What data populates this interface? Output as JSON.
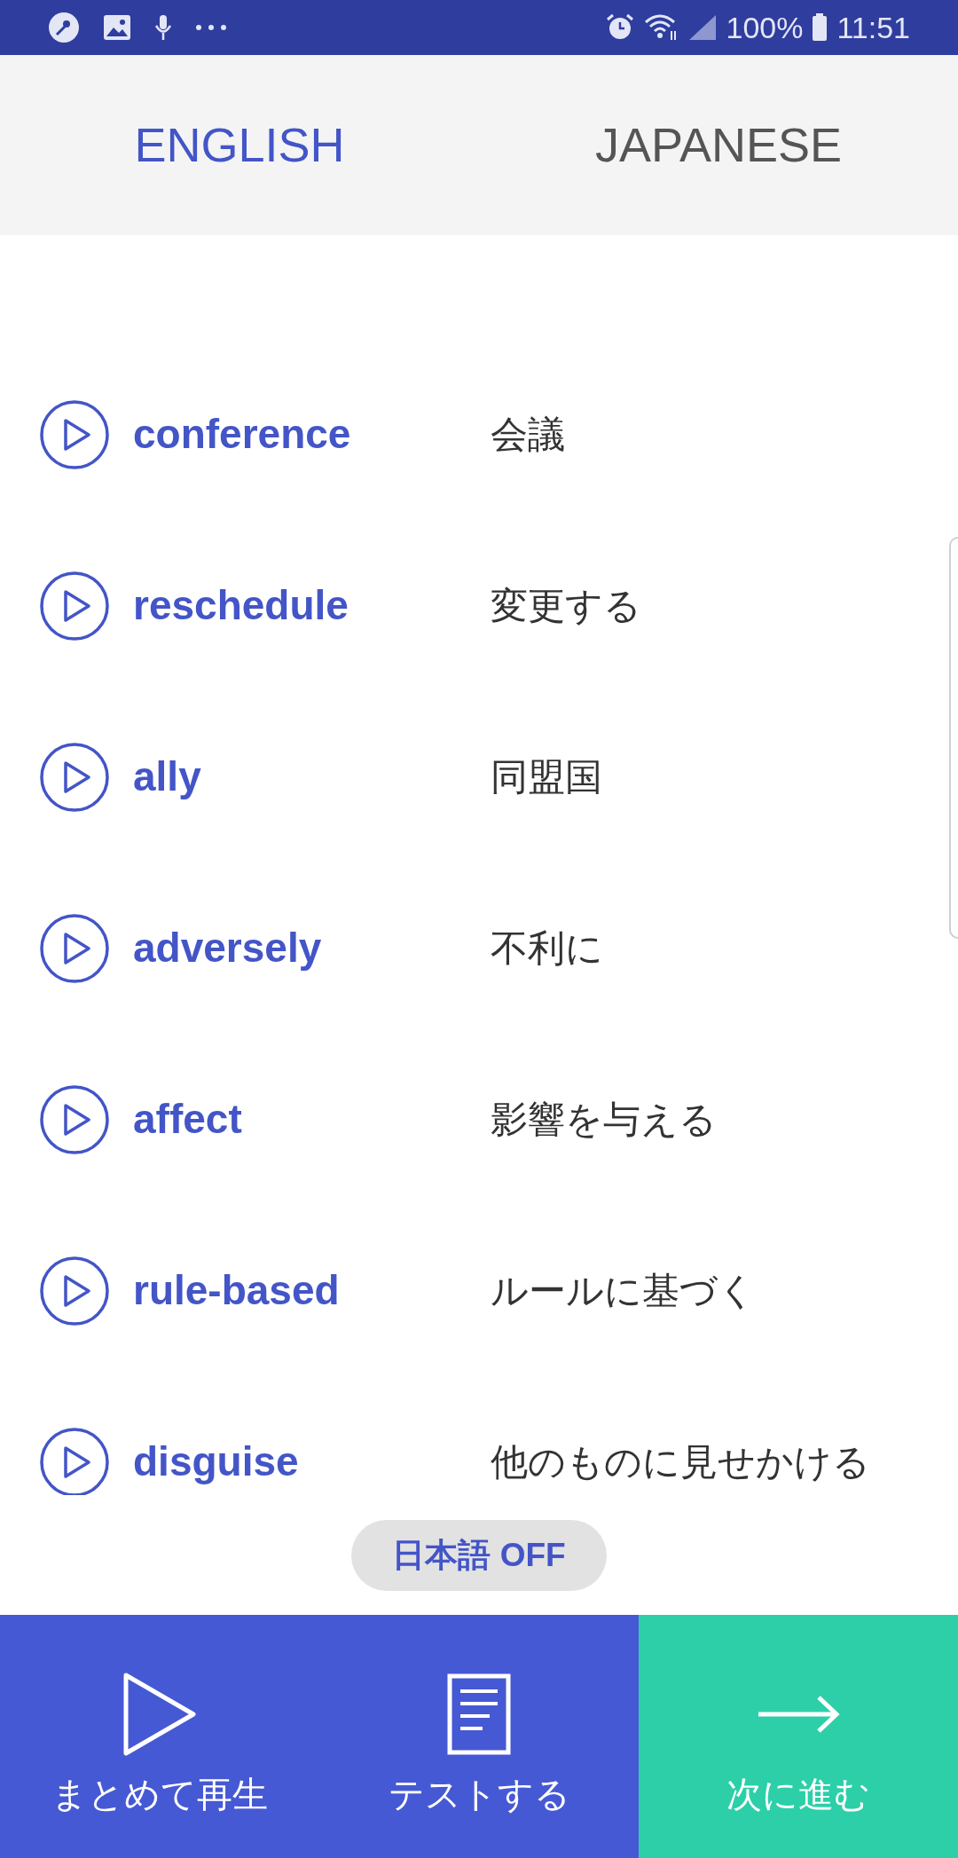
{
  "status_bar": {
    "battery": "100%",
    "time": "11:51"
  },
  "tabs": [
    {
      "label": "ENGLISH",
      "selected": true
    },
    {
      "label": "JAPANESE",
      "selected": false
    }
  ],
  "words": [
    {
      "english": "conference",
      "japanese": "会議"
    },
    {
      "english": "reschedule",
      "japanese": "変更する"
    },
    {
      "english": "ally",
      "japanese": "同盟国"
    },
    {
      "english": "adversely",
      "japanese": "不利に"
    },
    {
      "english": "affect",
      "japanese": "影響を与える"
    },
    {
      "english": "rule-based",
      "japanese": "ルールに基づく"
    },
    {
      "english": "disguise",
      "japanese": "他のものに見せかける"
    }
  ],
  "toggle": {
    "label": "日本語 OFF"
  },
  "actions": [
    {
      "kind": "play",
      "label": "まとめて再生"
    },
    {
      "kind": "test",
      "label": "テストする"
    },
    {
      "kind": "next",
      "label": "次に進む"
    }
  ]
}
